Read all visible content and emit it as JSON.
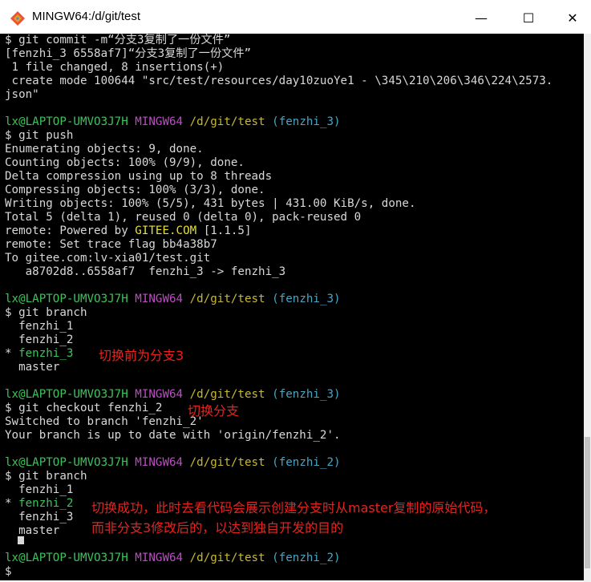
{
  "window": {
    "title": "MINGW64:/d/git/test",
    "controls": {
      "minimize": "—",
      "maximize": "☐",
      "close": "✕"
    },
    "colors": {
      "prompt_user": "#3bc45a",
      "prompt_host": "#c04ac8",
      "prompt_path": "#c9b930",
      "prompt_branch": "#4aa4c6",
      "annotation": "#e8231f"
    }
  },
  "prompt": {
    "user": "lx@LAPTOP-UMVO3J7H",
    "host": "MINGW64",
    "path": "/d/git/test",
    "branch3": "(fenzhi_3)",
    "branch2": "(fenzhi_2)"
  },
  "terminal": {
    "l1": "$ git commit -m“分支3复制了一份文件”",
    "l2": "[fenzhi_3 6558af7]“分支3复制了一份文件”",
    "l3": " 1 file changed, 8 insertions(+)",
    "l4": " create mode 100644 \"src/test/resources/day10zuoYe1 - \\345\\210\\206\\346\\224\\2573.",
    "l5": "json\"",
    "l7": "$ git push",
    "l8": "Enumerating objects: 9, done.",
    "l9": "Counting objects: 100% (9/9), done.",
    "l10": "Delta compression using up to 8 threads",
    "l11": "Compressing objects: 100% (3/3), done.",
    "l12": "Writing objects: 100% (5/5), 431 bytes | 431.00 KiB/s, done.",
    "l13": "Total 5 (delta 1), reused 0 (delta 0), pack-reused 0",
    "l14a": "remote: Powered by ",
    "l14b": "GITEE.COM",
    "l14c": " [1.1.5]",
    "l15": "remote: Set trace flag bb4a38b7",
    "l16": "To gitee.com:lv-xia01/test.git",
    "l17": "   a8702d8..6558af7  fenzhi_3 -> fenzhi_3",
    "l20": "$ git branch",
    "l21": "  fenzhi_1",
    "l22": "  fenzhi_2",
    "l23a": "* ",
    "l23b": "fenzhi_3",
    "l24": "  master",
    "l27": "$ git checkout fenzhi_2",
    "l28": "Switched to branch 'fenzhi_2'",
    "l29": "Your branch is up to date with 'origin/fenzhi_2'.",
    "l32": "$ git branch",
    "l33": "  fenzhi_1",
    "l34a": "* ",
    "l34b": "fenzhi_2",
    "l35": "  fenzhi_3",
    "l36": "  master",
    "l39": "$ "
  },
  "annotations": {
    "a1": "切换前为分支3",
    "a2": "切换分支",
    "a3": "切换成功，此时去看代码会展示创建分支时从master复制的原始代码，",
    "a4": "而非分支3修改后的，以达到独自开发的目的"
  }
}
